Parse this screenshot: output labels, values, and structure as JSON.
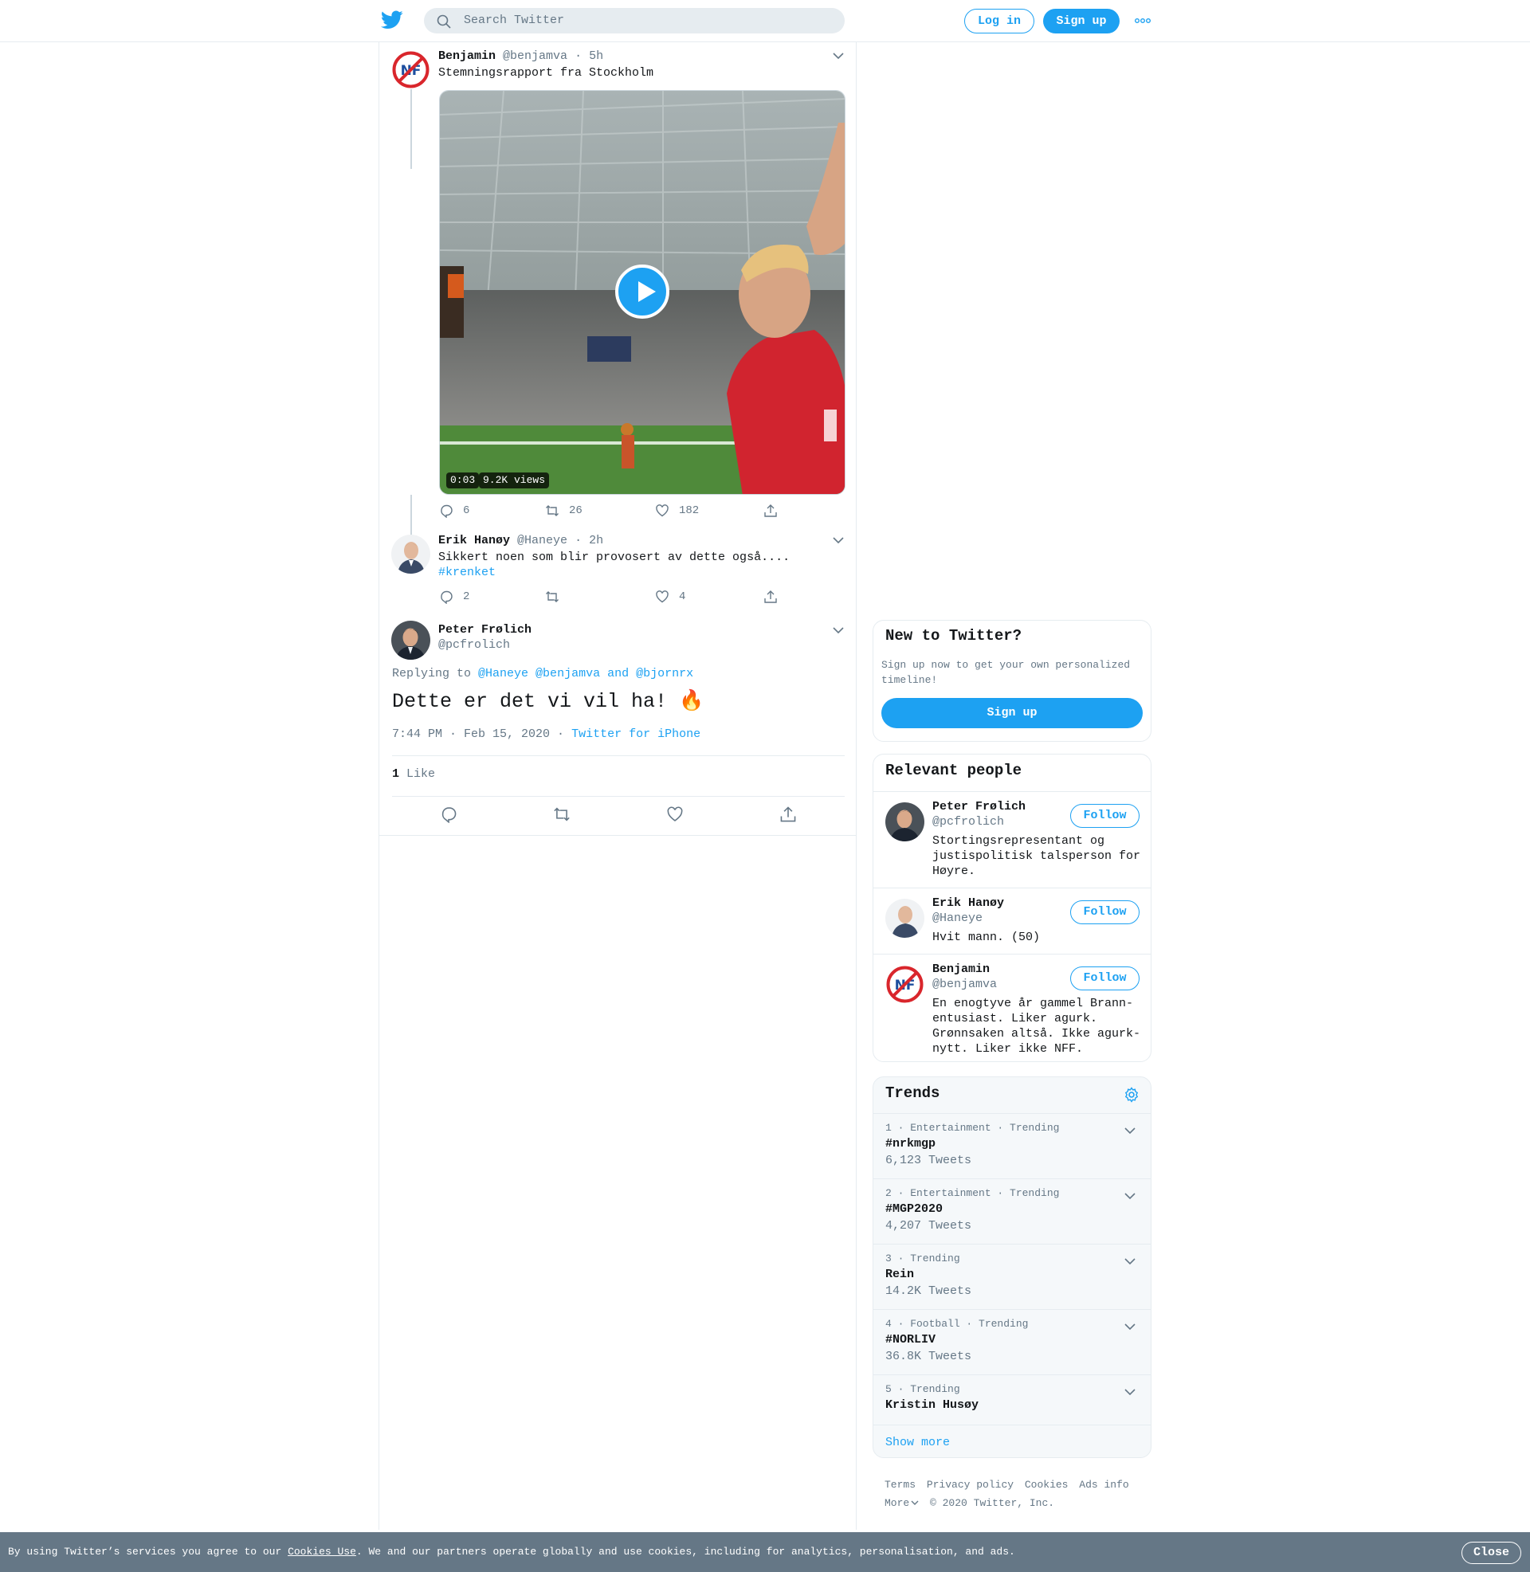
{
  "header": {
    "search_placeholder": "Search Twitter",
    "login_label": "Log in",
    "signup_label": "Sign up"
  },
  "thread": [
    {
      "name": "Benjamin",
      "handle": "@benjamva",
      "sep": "·",
      "time": "5h",
      "text": "Stemningsrapport fra Stockholm",
      "video": {
        "duration": "0:03",
        "views": "9.2K views"
      },
      "replies": "6",
      "retweets": "26",
      "likes": "182"
    },
    {
      "name": "Erik Hanøy",
      "handle": "@Haneye",
      "sep": "·",
      "time": "2h",
      "text": "Sikkert noen som blir provosert av dette også....",
      "hashtag": "#krenket",
      "replies": "2",
      "retweets": "",
      "likes": "4"
    }
  ],
  "focus_tweet": {
    "name": "Peter Frølich",
    "handle": "@pcfrolich",
    "replying_prefix": "Replying to",
    "replying_to": "@Haneye @benjamva and @bjornrx",
    "text": "Dette er det vi vil ha! 🔥",
    "datetime": "7:44 PM · Feb 15, 2020 ·",
    "source": "Twitter for iPhone",
    "like_count": "1",
    "like_label": "Like"
  },
  "sidebar": {
    "new_title": "New to Twitter?",
    "new_sub": "Sign up now to get your own personalized timeline!",
    "new_signup": "Sign up",
    "relevant_title": "Relevant people",
    "follow_label": "Follow",
    "people": [
      {
        "name": "Peter Frølich",
        "handle": "@pcfrolich",
        "bio": "Stortingsrepresentant og justispolitisk talsperson for Høyre."
      },
      {
        "name": "Erik Hanøy",
        "handle": "@Haneye",
        "bio": "Hvit mann. (50)"
      },
      {
        "name": "Benjamin",
        "handle": "@benjamva",
        "bio": "En enogtyve år gammel Brann-entusiast. Liker agurk. Grønnsaken altså. Ikke agurk-nytt. Liker ikke NFF."
      }
    ],
    "trends_title": "Trends",
    "trends": [
      {
        "meta": "1 · Entertainment · Trending",
        "name": "#nrkmgp",
        "count": "6,123 Tweets"
      },
      {
        "meta": "2 · Entertainment · Trending",
        "name": "#MGP2020",
        "count": "4,207 Tweets"
      },
      {
        "meta": "3 · Trending",
        "name": "Rein",
        "count": "14.2K Tweets"
      },
      {
        "meta": "4 · Football · Trending",
        "name": "#NORLIV",
        "count": "36.8K Tweets"
      },
      {
        "meta": "5 · Trending",
        "name": "Kristin Husøy",
        "count": ""
      }
    ],
    "show_more": "Show more",
    "footer": {
      "terms": "Terms",
      "privacy": "Privacy policy",
      "cookies": "Cookies",
      "ads": "Ads info",
      "more": "More",
      "copyright": "© 2020 Twitter, Inc."
    }
  },
  "cookie_bar": {
    "text_before": "By using Twitter’s services you agree to our ",
    "link": "Cookies Use",
    "text_after": ". We and our partners operate globally and use cookies, including for analytics, personalisation, and ads.",
    "close": "Close"
  },
  "colors": {
    "accent": "#1da1f2",
    "text": "#14171a",
    "muted": "#657786",
    "border": "#e6ecf0"
  }
}
